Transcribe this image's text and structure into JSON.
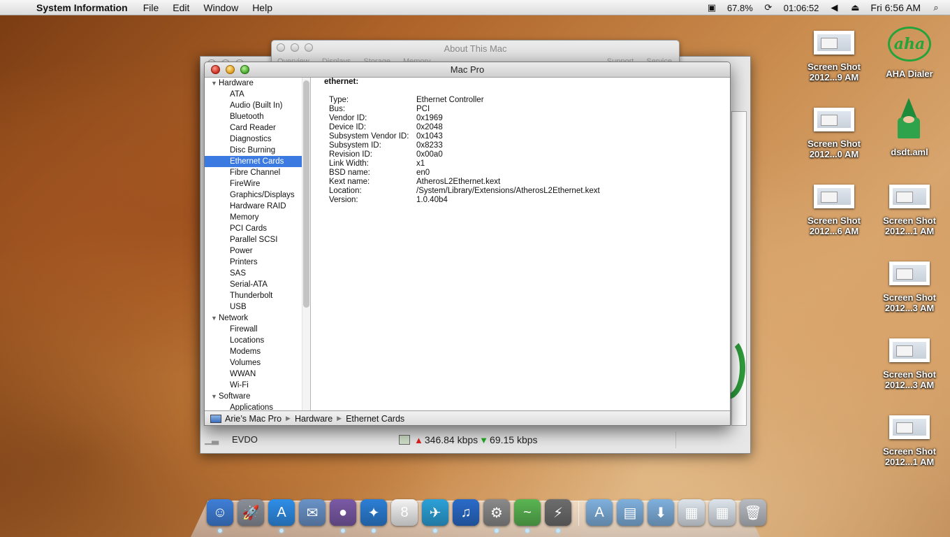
{
  "menubar": {
    "app_name": "System Information",
    "menus": [
      "File",
      "Edit",
      "Window",
      "Help"
    ],
    "battery_pct": "67.8%",
    "clock_timer": "01:06:52",
    "datetime": "Fri 6:56 AM"
  },
  "desktop_icons": [
    {
      "label_line1": "Screen Shot",
      "label_line2": "2012...9 AM",
      "kind": "screenshot"
    },
    {
      "label_line1": "AHA Dialer",
      "label_line2": "",
      "kind": "aha"
    },
    {
      "label_line1": "Screen Shot",
      "label_line2": "2012...0 AM",
      "kind": "screenshot"
    },
    {
      "label_line1": "dsdt.aml",
      "label_line2": "",
      "kind": "wizard"
    },
    {
      "label_line1": "Screen Shot",
      "label_line2": "2012...6 AM",
      "kind": "screenshot"
    },
    {
      "label_line1": "Screen Shot",
      "label_line2": "2012...1 AM",
      "kind": "screenshot"
    },
    {
      "label_line1": "Screen Shot",
      "label_line2": "2012...3 AM",
      "kind": "screenshot"
    },
    {
      "label_line1": "Screen Shot",
      "label_line2": "2012...3 AM",
      "kind": "screenshot"
    },
    {
      "label_line1": "Screen Shot",
      "label_line2": "2012...1 AM",
      "kind": "screenshot"
    }
  ],
  "about_window": {
    "title": "About This Mac",
    "tabs_left": [
      "Overview",
      "Displays",
      "Storage",
      "Memory"
    ],
    "tabs_right": [
      "Support",
      "Service"
    ]
  },
  "network_window": {
    "connection": "EVDO",
    "upload": "346.84 kbps",
    "download": "69.15 kbps"
  },
  "main_window": {
    "title": "Mac Pro",
    "sidebar": {
      "hardware_label": "Hardware",
      "hardware_items": [
        "ATA",
        "Audio (Built In)",
        "Bluetooth",
        "Card Reader",
        "Diagnostics",
        "Disc Burning",
        "Ethernet Cards",
        "Fibre Channel",
        "FireWire",
        "Graphics/Displays",
        "Hardware RAID",
        "Memory",
        "PCI Cards",
        "Parallel SCSI",
        "Power",
        "Printers",
        "SAS",
        "Serial-ATA",
        "Thunderbolt",
        "USB"
      ],
      "selected_index": 6,
      "network_label": "Network",
      "network_items": [
        "Firewall",
        "Locations",
        "Modems",
        "Volumes",
        "WWAN",
        "Wi-Fi"
      ],
      "software_label": "Software",
      "software_items": [
        "Applications"
      ]
    },
    "detail": {
      "heading": "ethernet:",
      "rows": [
        {
          "k": "Type:",
          "v": "Ethernet Controller"
        },
        {
          "k": "Bus:",
          "v": "PCI"
        },
        {
          "k": "Vendor ID:",
          "v": "0x1969"
        },
        {
          "k": "Device ID:",
          "v": "0x2048"
        },
        {
          "k": "Subsystem Vendor ID:",
          "v": "0x1043"
        },
        {
          "k": "Subsystem ID:",
          "v": "0x8233"
        },
        {
          "k": "Revision ID:",
          "v": "0x00a0"
        },
        {
          "k": "Link Width:",
          "v": "x1"
        },
        {
          "k": "BSD name:",
          "v": "en0"
        },
        {
          "k": "Kext name:",
          "v": "AtherosL2Ethernet.kext"
        },
        {
          "k": "Location:",
          "v": "/System/Library/Extensions/AtherosL2Ethernet.kext"
        },
        {
          "k": "Version:",
          "v": "1.0.40b4"
        }
      ]
    },
    "pathbar": [
      "Arie’s Mac Pro",
      "Hardware",
      "Ethernet Cards"
    ]
  },
  "dock": {
    "apps": [
      {
        "name": "finder-app",
        "glyph": "☺",
        "color": "#3f7fd8",
        "running": true
      },
      {
        "name": "launchpad-app",
        "glyph": "🚀",
        "color": "#8a8f99",
        "running": false
      },
      {
        "name": "app-store-app",
        "glyph": "A",
        "color": "#2f8ee8",
        "running": true
      },
      {
        "name": "mail-app",
        "glyph": "✉",
        "color": "#6a93c8",
        "running": false
      },
      {
        "name": "facetime-app",
        "glyph": "●",
        "color": "#7b5aa6",
        "running": true
      },
      {
        "name": "safari-app",
        "glyph": "✦",
        "color": "#2c7fd6",
        "running": true
      },
      {
        "name": "calendar-app",
        "glyph": "8",
        "color": "#f3f3f3",
        "running": false
      },
      {
        "name": "twitter-app",
        "glyph": "✈",
        "color": "#2ca1d8",
        "running": true
      },
      {
        "name": "itunes-app",
        "glyph": "♫",
        "color": "#2a6bc9",
        "running": false
      },
      {
        "name": "system-preferences-app",
        "glyph": "⚙",
        "color": "#8a8a8a",
        "running": true
      },
      {
        "name": "aha-dialer-app",
        "glyph": "~",
        "color": "#5ab552",
        "running": true
      },
      {
        "name": "system-information-app",
        "glyph": "⚡",
        "color": "#6d6d6d",
        "running": true
      }
    ],
    "stacks": [
      {
        "name": "applications-stack",
        "glyph": "A",
        "color": "#7fb0dd"
      },
      {
        "name": "documents-stack",
        "glyph": "▤",
        "color": "#7fb0dd"
      },
      {
        "name": "downloads-stack",
        "glyph": "⬇",
        "color": "#7fb0dd"
      },
      {
        "name": "screenshot-stack-1",
        "glyph": "▦",
        "color": "#dde4ec"
      },
      {
        "name": "screenshot-stack-2",
        "glyph": "▦",
        "color": "#dde4ec"
      },
      {
        "name": "trash",
        "glyph": "🗑",
        "color": "#b8bcc2"
      }
    ]
  }
}
